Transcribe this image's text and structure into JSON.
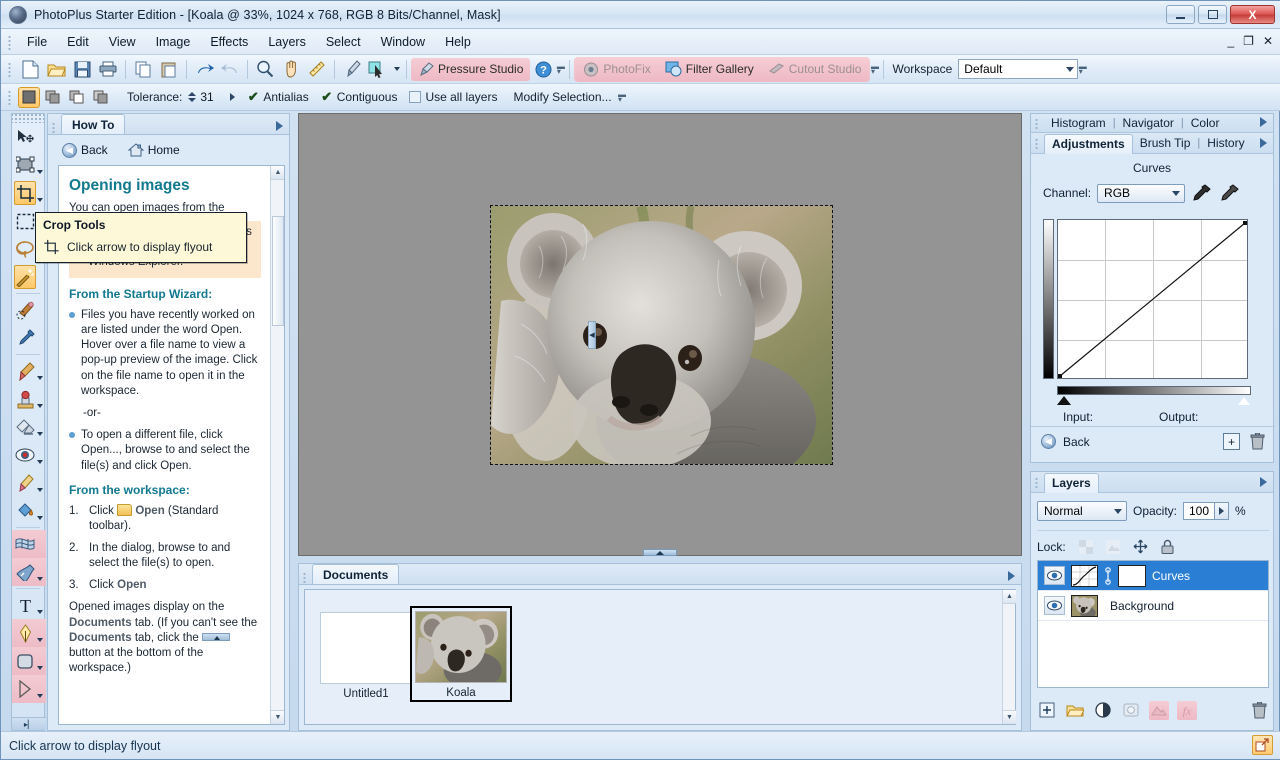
{
  "window": {
    "title": "PhotoPlus Starter Edition - [Koala @ 33%, 1024 x 768, RGB 8 Bits/Channel, Mask]",
    "minimize_label": "",
    "maximize_label": "",
    "close_label": "X",
    "mdi_minimize": "_",
    "mdi_restore": "❐",
    "mdi_close": "✕"
  },
  "menu": {
    "items": [
      {
        "label": "File"
      },
      {
        "label": "Edit"
      },
      {
        "label": "View"
      },
      {
        "label": "Image"
      },
      {
        "label": "Effects"
      },
      {
        "label": "Layers"
      },
      {
        "label": "Select"
      },
      {
        "label": "Window"
      },
      {
        "label": "Help"
      }
    ]
  },
  "toolbar": {
    "icons": [
      {
        "name": "new-document-icon"
      },
      {
        "name": "open-folder-icon"
      },
      {
        "name": "save-icon"
      },
      {
        "name": "print-icon"
      },
      {
        "name": "copy-icon"
      },
      {
        "name": "paste-icon"
      },
      {
        "name": "undo-icon"
      },
      {
        "name": "redo-icon"
      },
      {
        "name": "zoom-icon"
      },
      {
        "name": "pan-hand-icon"
      },
      {
        "name": "measure-icon"
      },
      {
        "name": "brush-icon"
      },
      {
        "name": "pointer-picker-icon"
      }
    ],
    "pressure_studio": "Pressure Studio",
    "help_label": "?",
    "photofix": "PhotoFix",
    "filter_gallery": "Filter Gallery",
    "cutout_studio": "Cutout Studio",
    "workspace_label": "Workspace",
    "workspace_value": "Default"
  },
  "options_bar": {
    "selection_modes": [
      {
        "name": "new-selection",
        "active": true
      },
      {
        "name": "add-to-selection",
        "active": false
      },
      {
        "name": "subtract-from-selection",
        "active": false
      },
      {
        "name": "intersect-selection",
        "active": false
      }
    ],
    "tolerance_label": "Tolerance:",
    "tolerance_value": "31",
    "antialias_label": "Antialias",
    "antialias_checked": true,
    "contiguous_label": "Contiguous",
    "contiguous_checked": true,
    "use_all_layers_label": "Use all layers",
    "use_all_layers_checked": false,
    "modify_selection_label": "Modify Selection..."
  },
  "toolbox": {
    "tools": [
      {
        "name": "move-tool",
        "selected": false,
        "flyout": false,
        "pink": false
      },
      {
        "name": "transform-tool",
        "selected": false,
        "flyout": true,
        "pink": false
      },
      {
        "name": "crop-tool",
        "selected": true,
        "flyout": true,
        "pink": false
      },
      {
        "name": "rectangle-select-tool",
        "selected": false,
        "flyout": true,
        "pink": false
      },
      {
        "name": "lasso-select-tool",
        "selected": false,
        "flyout": true,
        "pink": false
      },
      {
        "name": "magic-wand-tool",
        "selected": true,
        "flyout": false,
        "pink": false
      },
      {
        "name": "clone-brush-tool",
        "selected": false,
        "flyout": false,
        "pink": false
      },
      {
        "name": "color-picker-tool",
        "selected": false,
        "flyout": false,
        "pink": false
      },
      {
        "name": "paintbrush-tool",
        "selected": false,
        "flyout": true,
        "pink": false
      },
      {
        "name": "clone-stamp-tool",
        "selected": false,
        "flyout": true,
        "pink": false
      },
      {
        "name": "eraser-tool",
        "selected": false,
        "flyout": true,
        "pink": false
      },
      {
        "name": "red-eye-tool",
        "selected": false,
        "flyout": true,
        "pink": false
      },
      {
        "name": "smudge-tool",
        "selected": false,
        "flyout": true,
        "pink": false
      },
      {
        "name": "paint-bucket-tool",
        "selected": false,
        "flyout": true,
        "pink": false
      },
      {
        "name": "mesh-warp-tool",
        "selected": false,
        "flyout": false,
        "pink": true
      },
      {
        "name": "warp-brush-tool",
        "selected": false,
        "flyout": true,
        "pink": true
      },
      {
        "name": "text-tool",
        "selected": false,
        "flyout": true,
        "pink": false
      },
      {
        "name": "pen-tool",
        "selected": false,
        "flyout": true,
        "pink": true
      },
      {
        "name": "shape-tool",
        "selected": false,
        "flyout": true,
        "pink": true
      },
      {
        "name": "node-edit-tool",
        "selected": false,
        "flyout": true,
        "pink": true
      }
    ],
    "collapse_label": "▸▏"
  },
  "tooltip": {
    "title": "Crop Tools",
    "body": "Click arrow to display flyout",
    "icon": "crop-tool-icon"
  },
  "howto": {
    "tab_label": "How To",
    "back_label": "Back",
    "home_label": "Home",
    "heading": "Opening images",
    "intro": "You can open images from the",
    "tip_text": "You can also drag and drop files directly into PhotoPlus from Windows Explorer.",
    "wizard_heading": "From the Startup Wizard:",
    "wizard_bullet_1": "Files you have recently worked on are listed under the word Open. Hover over a file name to view a pop-up preview of the image. Click on the file name to open it in the workspace.",
    "or_label": "-or-",
    "wizard_bullet_2": "To open a different file, click Open..., browse to and select the file(s) and click Open.",
    "workspace_heading": "From the workspace:",
    "steps": [
      {
        "num": "1.",
        "text_before": "Click",
        "bold": "Open",
        "text_after": "(Standard toolbar)."
      },
      {
        "num": "2.",
        "text_before": "In the dialog, browse to and select the file(s) to open.",
        "bold": "",
        "text_after": ""
      },
      {
        "num": "3.",
        "text_before": "Click",
        "bold": "Open",
        "text_after": ""
      }
    ],
    "closing_1": "Opened images display on the",
    "closing_docs": "Documents",
    "closing_2": "tab. (If you can't see the",
    "closing_3": "tab, click the",
    "closing_4": "button at the bottom of the workspace.)"
  },
  "canvas": {
    "zoom": "33%",
    "image_name": "Koala",
    "dimensions": "1024 x 768"
  },
  "documents": {
    "tab_label": "Documents",
    "items": [
      {
        "label": "Untitled1",
        "selected": false,
        "type": "blank"
      },
      {
        "label": "Koala",
        "selected": true,
        "type": "koala"
      }
    ]
  },
  "adjustments": {
    "top_tabs": [
      {
        "label": "Histogram",
        "active": false
      },
      {
        "label": "Navigator",
        "active": false
      },
      {
        "label": "Color",
        "active": false
      }
    ],
    "tabs": [
      {
        "label": "Adjustments",
        "active": true
      },
      {
        "label": "Brush Tip",
        "active": false
      },
      {
        "label": "History",
        "active": false
      }
    ],
    "title": "Curves",
    "channel_label": "Channel:",
    "channel_value": "RGB",
    "input_label": "Input:",
    "output_label": "Output:",
    "input_value": "",
    "output_value": "",
    "back_label": "Back",
    "add_icon": "+",
    "delete_icon": "delete-icon"
  },
  "chart_data": {
    "type": "line",
    "title": "Curves",
    "xlabel": "Input",
    "ylabel": "Output",
    "xlim": [
      0,
      255
    ],
    "ylim": [
      0,
      255
    ],
    "grid": true,
    "grid_divisions": 4,
    "series": [
      {
        "name": "RGB",
        "x": [
          0,
          255
        ],
        "y": [
          0,
          255
        ]
      }
    ],
    "control_points": [
      [
        0,
        0
      ],
      [
        255,
        255
      ]
    ],
    "legend": "none"
  },
  "layers": {
    "tab_label": "Layers",
    "blend_mode": "Normal",
    "opacity_label": "Opacity:",
    "opacity_value": "100",
    "percent_label": "%",
    "lock_label": "Lock:",
    "lock_icons": [
      {
        "name": "lock-transparency-icon"
      },
      {
        "name": "lock-pixels-icon"
      },
      {
        "name": "lock-position-icon"
      },
      {
        "name": "lock-all-icon"
      }
    ],
    "rows": [
      {
        "name": "Curves",
        "selected": true,
        "visible": true,
        "has_mask": true,
        "thumb": "curves"
      },
      {
        "name": "Background",
        "selected": false,
        "visible": true,
        "has_mask": false,
        "thumb": "koala"
      }
    ],
    "footer_buttons": [
      {
        "name": "add-layer-button",
        "enabled": true
      },
      {
        "name": "layer-group-button",
        "enabled": true
      },
      {
        "name": "adjustment-layer-button",
        "enabled": true
      },
      {
        "name": "layer-mask-button",
        "enabled": false
      },
      {
        "name": "layer-effects-button",
        "enabled": false
      },
      {
        "name": "fx-button",
        "enabled": false
      },
      {
        "name": "delete-layer-button",
        "enabled": true
      }
    ]
  },
  "statusbar": {
    "message": "Click arrow to display flyout",
    "resize_grip": "resize-grip-icon"
  },
  "colors": {
    "accent_blue": "#2a7fd4",
    "teal_heading": "#12798f",
    "tooltip_bg": "#fdf8d8",
    "pink_toolbar": "#f3cbd3",
    "orange_selected": "#ffc867",
    "canvas_gray": "#949494"
  }
}
